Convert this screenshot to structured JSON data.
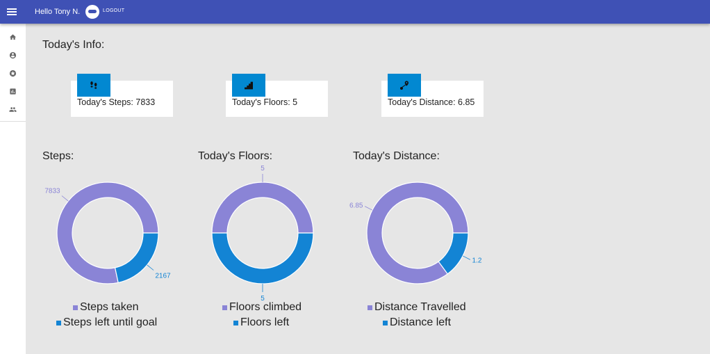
{
  "header": {
    "greeting": "Hello Tony N.",
    "logout_label": "LOGOUT",
    "icons": [
      "menu-icon",
      "avatar-icon"
    ]
  },
  "sidebar": {
    "items": [
      {
        "name": "home",
        "icon": "home-icon"
      },
      {
        "name": "profile",
        "icon": "account-circle-icon"
      },
      {
        "name": "achievements",
        "icon": "star-circle-icon"
      },
      {
        "name": "stats",
        "icon": "bar-chart-icon"
      },
      {
        "name": "friends",
        "icon": "people-icon"
      }
    ]
  },
  "page": {
    "title": "Today's Info:"
  },
  "cards": [
    {
      "icon": "footsteps-icon",
      "text": "Today's Steps: 7833"
    },
    {
      "icon": "stairs-icon",
      "text": "Today's Floors: 5"
    },
    {
      "icon": "route-icon",
      "text": "Today's Distance: 6.85"
    }
  ],
  "colors": {
    "appbar": "#3f51b5",
    "accent": "#0288d1",
    "purple": "#8a84d6",
    "blue": "#1384d4"
  },
  "chart_data": [
    {
      "type": "pie",
      "title": "Steps:",
      "categories": [
        "Steps taken",
        "Steps left until goal"
      ],
      "values": [
        7833,
        2167
      ],
      "colors": [
        "#8a84d6",
        "#1384d4"
      ]
    },
    {
      "type": "pie",
      "title": "Today's Floors:",
      "categories": [
        "Floors climbed",
        "Floors left"
      ],
      "values": [
        5,
        5
      ],
      "colors": [
        "#8a84d6",
        "#1384d4"
      ]
    },
    {
      "type": "pie",
      "title": "Today's Distance:",
      "categories": [
        "Distance Travelled",
        "Distance left"
      ],
      "values": [
        6.85,
        1.2
      ],
      "colors": [
        "#8a84d6",
        "#1384d4"
      ]
    }
  ]
}
